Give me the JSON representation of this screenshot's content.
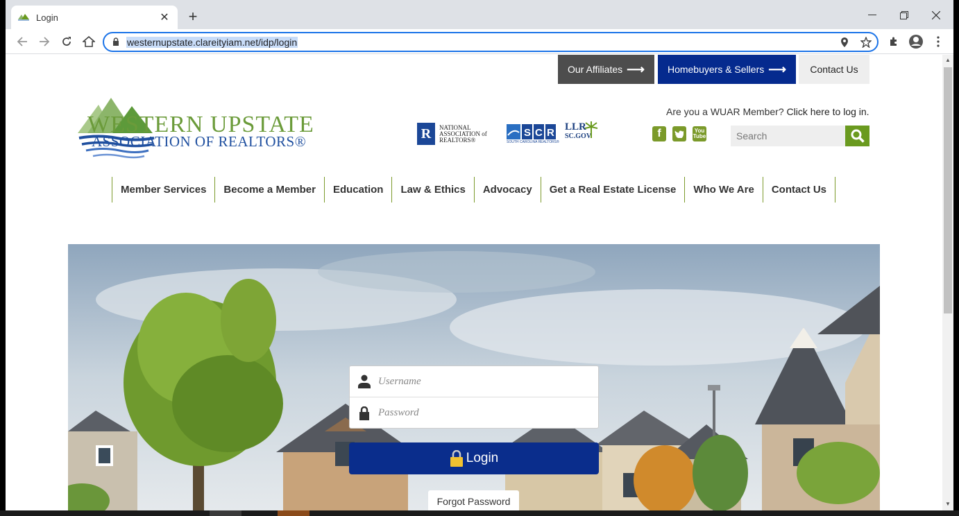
{
  "browser": {
    "tab_title": "Login",
    "url": "westernupstate.clareityiam.net/idp/login",
    "new_tab_label": "+",
    "close_tab_label": "✕"
  },
  "topbar": {
    "affiliates": "Our Affiliates",
    "homebuyers": "Homebuyers & Sellers",
    "contact": "Contact Us"
  },
  "logo": {
    "line1": "WESTERN UPSTATE",
    "line2": "ASSOCIATION OF REALTORS®"
  },
  "partners": {
    "nar_letter": "R",
    "nar_text": [
      "NATIONAL",
      "ASSOCIATION of",
      "REALTORS®"
    ],
    "scr_sub": "SOUTH CAROLINA REALTORS®",
    "llr_line1": "LLR",
    "llr_line2": "SC.GOV"
  },
  "header": {
    "member_prompt": "Are you a WUAR Member?",
    "member_link": "Click here to log in.",
    "search_placeholder": "Search"
  },
  "nav": [
    {
      "label": "Member Services"
    },
    {
      "label": "Become a Member"
    },
    {
      "label": "Education"
    },
    {
      "label": "Law & Ethics"
    },
    {
      "label": "Advocacy"
    },
    {
      "label": "Get a Real Estate License"
    },
    {
      "label": "Who We Are"
    },
    {
      "label": "Contact Us"
    }
  ],
  "login": {
    "username_placeholder": "Username",
    "password_placeholder": "Password",
    "login_label": "Login",
    "forgot_label": "Forgot Password"
  },
  "colors": {
    "brand_green": "#6a9a1f",
    "brand_blue": "#052a8e",
    "dark_gray": "#4d4d4d"
  }
}
